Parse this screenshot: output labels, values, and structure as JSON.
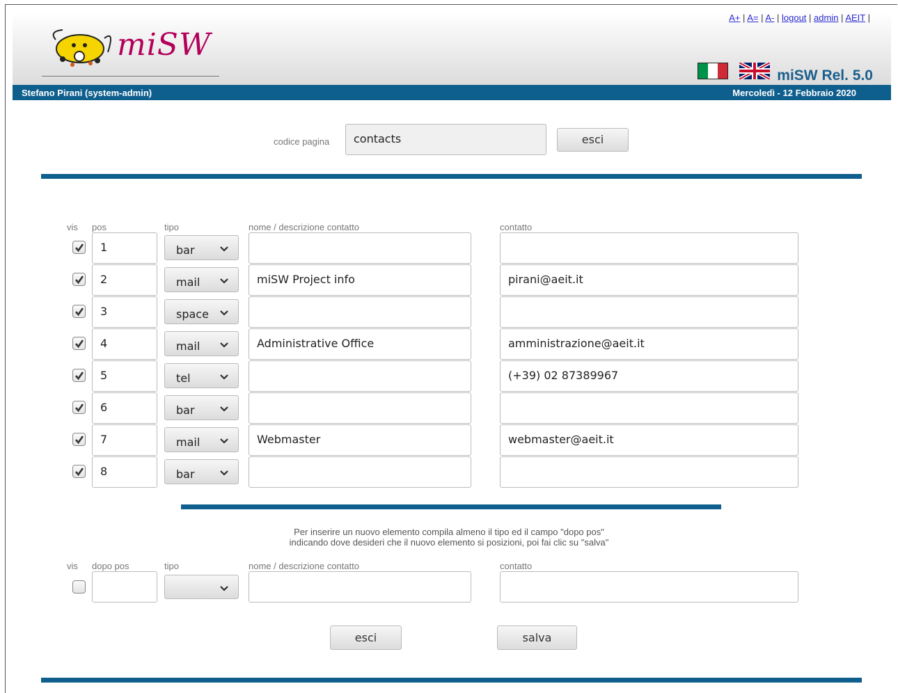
{
  "header": {
    "logo_text": "miSW",
    "links": [
      "A+",
      "A=",
      "A-",
      "logout",
      "admin",
      "AEIT"
    ],
    "release": "miSW Rel. 5.0",
    "flags": [
      "italian-flag-icon",
      "uk-flag-icon"
    ]
  },
  "userbar": {
    "user": "Stefano Pirani (system-admin)",
    "date": "Mercoledì - 12 Febbraio 2020"
  },
  "page_code": {
    "label": "codice pagina",
    "value": "contacts",
    "exit_label": "esci"
  },
  "table": {
    "headers": {
      "vis": "vis",
      "pos": "pos",
      "tipo": "tipo",
      "nome": "nome / descrizione contatto",
      "contatto": "contatto"
    },
    "rows": [
      {
        "vis": true,
        "pos": "1",
        "tipo": "bar",
        "nome": "",
        "contatto": ""
      },
      {
        "vis": true,
        "pos": "2",
        "tipo": "mail",
        "nome": "miSW Project info",
        "contatto": "pirani@aeit.it"
      },
      {
        "vis": true,
        "pos": "3",
        "tipo": "space",
        "nome": "",
        "contatto": ""
      },
      {
        "vis": true,
        "pos": "4",
        "tipo": "mail",
        "nome": "Administrative Office",
        "contatto": "amministrazione@aeit.it"
      },
      {
        "vis": true,
        "pos": "5",
        "tipo": "tel",
        "nome": "",
        "contatto": "(+39) 02 87389967"
      },
      {
        "vis": true,
        "pos": "6",
        "tipo": "bar",
        "nome": "",
        "contatto": ""
      },
      {
        "vis": true,
        "pos": "7",
        "tipo": "mail",
        "nome": "Webmaster",
        "contatto": "webmaster@aeit.it"
      },
      {
        "vis": true,
        "pos": "8",
        "tipo": "bar",
        "nome": "",
        "contatto": ""
      }
    ]
  },
  "new_item": {
    "note_line1": "Per inserire un nuovo elemento compila almeno il tipo ed il campo \"dopo pos\"",
    "note_line2": "indicando dove desideri che il nuovo elemento si posizioni, poi fai clic su \"salva\"",
    "headers": {
      "vis": "vis",
      "pos": "dopo pos",
      "tipo": "tipo",
      "nome": "nome / descrizione contatto",
      "contatto": "contatto"
    },
    "vis": false,
    "pos": "",
    "tipo": "",
    "nome": "",
    "contatto": ""
  },
  "footer_buttons": {
    "exit_label": "esci",
    "save_label": "salva"
  },
  "colors": {
    "accent": "#0f5f8e",
    "logo": "#b3005a"
  }
}
